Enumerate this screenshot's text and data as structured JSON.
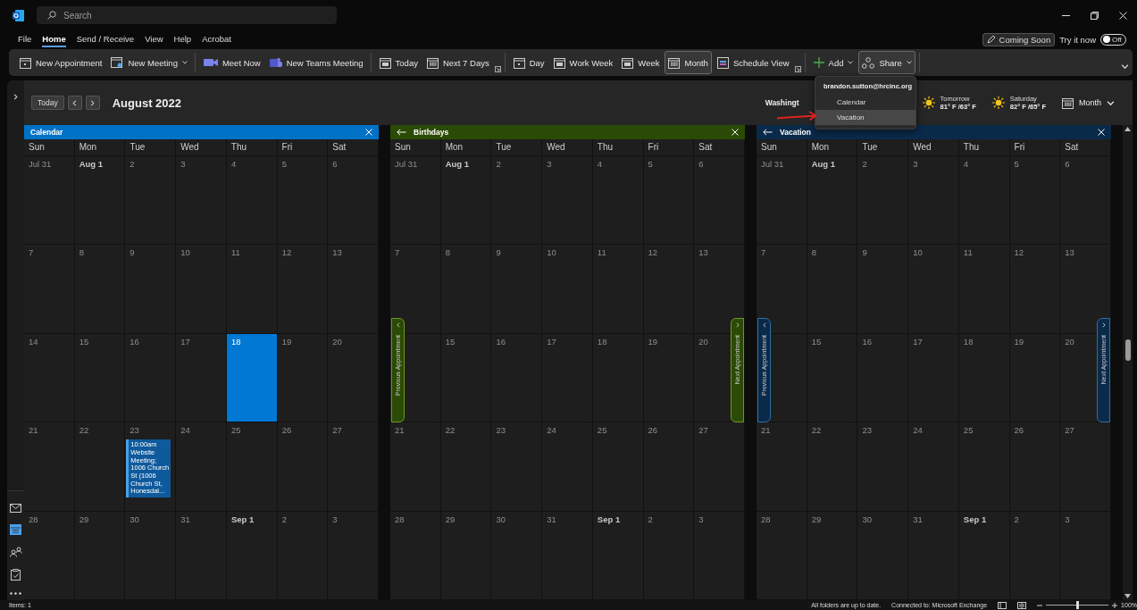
{
  "title_bar": {
    "search": {
      "placeholder": "Search"
    }
  },
  "menu": {
    "tabs": [
      {
        "label": "File",
        "selected": false
      },
      {
        "label": "Home",
        "selected": true
      },
      {
        "label": "Send / Receive",
        "selected": false
      },
      {
        "label": "View",
        "selected": false
      },
      {
        "label": "Help",
        "selected": false
      },
      {
        "label": "Acrobat",
        "selected": false
      }
    ],
    "coming_soon": "Coming Soon",
    "try_it_now": "Try it now",
    "toggle": {
      "label": "Off",
      "on": false
    }
  },
  "ribbon": {
    "groups": [
      {
        "launcher": false,
        "items": [
          {
            "label": "New Appointment",
            "caret": false,
            "active": false
          },
          {
            "label": "New Meeting",
            "caret": true,
            "active": false
          }
        ]
      },
      {
        "launcher": false,
        "items": [
          {
            "label": "Meet Now",
            "caret": false,
            "active": false
          },
          {
            "label": "New Teams Meeting",
            "caret": false,
            "active": false
          }
        ]
      },
      {
        "launcher": true,
        "items": [
          {
            "label": "Today",
            "caret": false,
            "active": false
          },
          {
            "label": "Next 7 Days",
            "caret": false,
            "active": false
          }
        ]
      },
      {
        "launcher": true,
        "items": [
          {
            "label": "Day",
            "caret": false,
            "active": false
          },
          {
            "label": "Work Week",
            "caret": false,
            "active": false
          },
          {
            "label": "Week",
            "caret": false,
            "active": false
          },
          {
            "label": "Month",
            "caret": false,
            "active": true
          },
          {
            "label": "Schedule View",
            "caret": false,
            "active": false
          }
        ]
      },
      {
        "launcher": false,
        "items": [
          {
            "label": "Add",
            "caret": true,
            "active": false
          },
          {
            "label": "Share",
            "caret": true,
            "active": true
          }
        ]
      }
    ]
  },
  "nav_rail": {
    "items": [
      {
        "selected": false
      },
      {
        "selected": true
      },
      {
        "selected": false
      },
      {
        "selected": false
      }
    ]
  },
  "header": {
    "today_button": "Today",
    "month_title": "August 2022",
    "location": "Washingt",
    "weather": [
      {
        "day": "Tomorrow",
        "temp": "81° F /63° F"
      },
      {
        "day": "Saturday",
        "temp": "82° F /65° F"
      }
    ],
    "view_picker": "Month"
  },
  "share_menu": {
    "account": "brandon.sutton@hrcinc.org",
    "items": [
      {
        "label": "Calendar",
        "highlighted": false
      },
      {
        "label": "Vacation",
        "highlighted": true
      }
    ]
  },
  "calendars": [
    {
      "title": "Calendar",
      "color": "#0072c6",
      "kind": "primary",
      "weekdays": [
        "Sun",
        "Mon",
        "Tue",
        "Wed",
        "Thu",
        "Fri",
        "Sat"
      ],
      "weeks": [
        [
          {
            "label": "Jul 31",
            "bold": false,
            "today": false
          },
          {
            "label": "Aug 1",
            "bold": true,
            "today": false
          },
          {
            "label": "2",
            "bold": false,
            "today": false
          },
          {
            "label": "3",
            "bold": false,
            "today": false
          },
          {
            "label": "4",
            "bold": false,
            "today": false
          },
          {
            "label": "5",
            "bold": false,
            "today": false
          },
          {
            "label": "6",
            "bold": false,
            "today": false
          }
        ],
        [
          {
            "label": "7",
            "bold": false,
            "today": false
          },
          {
            "label": "8",
            "bold": false,
            "today": false
          },
          {
            "label": "9",
            "bold": false,
            "today": false
          },
          {
            "label": "10",
            "bold": false,
            "today": false
          },
          {
            "label": "11",
            "bold": false,
            "today": false
          },
          {
            "label": "12",
            "bold": false,
            "today": false
          },
          {
            "label": "13",
            "bold": false,
            "today": false
          }
        ],
        [
          {
            "label": "14",
            "bold": false,
            "today": false
          },
          {
            "label": "15",
            "bold": false,
            "today": false
          },
          {
            "label": "16",
            "bold": false,
            "today": false
          },
          {
            "label": "17",
            "bold": false,
            "today": false
          },
          {
            "label": "18",
            "bold": false,
            "today": true
          },
          {
            "label": "19",
            "bold": false,
            "today": false
          },
          {
            "label": "20",
            "bold": false,
            "today": false
          }
        ],
        [
          {
            "label": "21",
            "bold": false,
            "today": false
          },
          {
            "label": "22",
            "bold": false,
            "today": false
          },
          {
            "label": "23",
            "bold": false,
            "today": false,
            "events": [
              "10:00am Website Meeting; 1006 Church St (1006 Church St, Honesdal..."
            ]
          },
          {
            "label": "24",
            "bold": false,
            "today": false
          },
          {
            "label": "25",
            "bold": false,
            "today": false
          },
          {
            "label": "26",
            "bold": false,
            "today": false
          },
          {
            "label": "27",
            "bold": false,
            "today": false
          }
        ],
        [
          {
            "label": "28",
            "bold": false,
            "today": false
          },
          {
            "label": "29",
            "bold": false,
            "today": false
          },
          {
            "label": "30",
            "bold": false,
            "today": false
          },
          {
            "label": "31",
            "bold": false,
            "today": false
          },
          {
            "label": "Sep 1",
            "bold": true,
            "today": false
          },
          {
            "label": "2",
            "bold": false,
            "today": false
          },
          {
            "label": "3",
            "bold": false,
            "today": false
          }
        ]
      ]
    },
    {
      "title": "Birthdays",
      "color": "#2b4a05",
      "kind": "overlay",
      "previous_tab": "Previous Appointment",
      "next_tab": "Next Appointment",
      "weekdays": [
        "Sun",
        "Mon",
        "Tue",
        "Wed",
        "Thu",
        "Fri",
        "Sat"
      ],
      "weeks": [
        [
          {
            "label": "Jul 31",
            "bold": false,
            "today": false
          },
          {
            "label": "Aug 1",
            "bold": true,
            "today": false
          },
          {
            "label": "2",
            "bold": false,
            "today": false
          },
          {
            "label": "3",
            "bold": false,
            "today": false
          },
          {
            "label": "4",
            "bold": false,
            "today": false
          },
          {
            "label": "5",
            "bold": false,
            "today": false
          },
          {
            "label": "6",
            "bold": false,
            "today": false
          }
        ],
        [
          {
            "label": "7",
            "bold": false,
            "today": false
          },
          {
            "label": "8",
            "bold": false,
            "today": false
          },
          {
            "label": "9",
            "bold": false,
            "today": false
          },
          {
            "label": "10",
            "bold": false,
            "today": false
          },
          {
            "label": "11",
            "bold": false,
            "today": false
          },
          {
            "label": "12",
            "bold": false,
            "today": false
          },
          {
            "label": "13",
            "bold": false,
            "today": false
          }
        ],
        [
          {
            "today": false
          },
          {
            "label": "15",
            "bold": false,
            "today": false
          },
          {
            "label": "16",
            "bold": false,
            "today": false
          },
          {
            "label": "17",
            "bold": false,
            "today": false
          },
          {
            "label": "18",
            "bold": false,
            "today": false
          },
          {
            "label": "19",
            "bold": false,
            "today": false
          },
          {
            "label": "20",
            "bold": false,
            "today": false
          }
        ],
        [
          {
            "label": "21",
            "bold": false,
            "today": false
          },
          {
            "label": "22",
            "bold": false,
            "today": false
          },
          {
            "label": "23",
            "bold": false,
            "today": false
          },
          {
            "label": "24",
            "bold": false,
            "today": false
          },
          {
            "label": "25",
            "bold": false,
            "today": false
          },
          {
            "label": "26",
            "bold": false,
            "today": false
          },
          {
            "label": "27",
            "bold": false,
            "today": false
          }
        ],
        [
          {
            "label": "28",
            "bold": false,
            "today": false
          },
          {
            "label": "29",
            "bold": false,
            "today": false
          },
          {
            "label": "30",
            "bold": false,
            "today": false
          },
          {
            "label": "31",
            "bold": false,
            "today": false
          },
          {
            "label": "Sep 1",
            "bold": true,
            "today": false
          },
          {
            "label": "2",
            "bold": false,
            "today": false
          },
          {
            "label": "3",
            "bold": false,
            "today": false
          }
        ]
      ]
    },
    {
      "title": "Vacation",
      "color": "#0a2a4a",
      "kind": "overlay",
      "previous_tab": "Previous Appointment",
      "next_tab": "Next Appointment",
      "weekdays": [
        "Sun",
        "Mon",
        "Tue",
        "Wed",
        "Thu",
        "Fri",
        "Sat"
      ],
      "weeks": [
        [
          {
            "label": "Jul 31",
            "bold": false,
            "today": false
          },
          {
            "label": "Aug 1",
            "bold": true,
            "today": false
          },
          {
            "label": "2",
            "bold": false,
            "today": false
          },
          {
            "label": "3",
            "bold": false,
            "today": false
          },
          {
            "label": "4",
            "bold": false,
            "today": false
          },
          {
            "label": "5",
            "bold": false,
            "today": false
          },
          {
            "label": "6",
            "bold": false,
            "today": false
          }
        ],
        [
          {
            "label": "7",
            "bold": false,
            "today": false
          },
          {
            "label": "8",
            "bold": false,
            "today": false
          },
          {
            "label": "9",
            "bold": false,
            "today": false
          },
          {
            "label": "10",
            "bold": false,
            "today": false
          },
          {
            "label": "11",
            "bold": false,
            "today": false
          },
          {
            "label": "12",
            "bold": false,
            "today": false
          },
          {
            "label": "13",
            "bold": false,
            "today": false
          }
        ],
        [
          {
            "today": false
          },
          {
            "label": "15",
            "bold": false,
            "today": false
          },
          {
            "label": "16",
            "bold": false,
            "today": false
          },
          {
            "label": "17",
            "bold": false,
            "today": false
          },
          {
            "label": "18",
            "bold": false,
            "today": false
          },
          {
            "label": "19",
            "bold": false,
            "today": false
          },
          {
            "label": "20",
            "bold": false,
            "today": false
          }
        ],
        [
          {
            "label": "21",
            "bold": false,
            "today": false
          },
          {
            "label": "22",
            "bold": false,
            "today": false
          },
          {
            "label": "23",
            "bold": false,
            "today": false
          },
          {
            "label": "24",
            "bold": false,
            "today": false
          },
          {
            "label": "25",
            "bold": false,
            "today": false
          },
          {
            "label": "26",
            "bold": false,
            "today": false
          },
          {
            "label": "27",
            "bold": false,
            "today": false
          }
        ],
        [
          {
            "label": "28",
            "bold": false,
            "today": false
          },
          {
            "label": "29",
            "bold": false,
            "today": false
          },
          {
            "label": "30",
            "bold": false,
            "today": false
          },
          {
            "label": "31",
            "bold": false,
            "today": false
          },
          {
            "label": "Sep 1",
            "bold": true,
            "today": false
          },
          {
            "label": "2",
            "bold": false,
            "today": false
          },
          {
            "label": "3",
            "bold": false,
            "today": false
          }
        ]
      ]
    }
  ],
  "status_bar": {
    "items": "Items: 1",
    "sync": "All folders are up to date.",
    "connection": "Connected to: Microsoft Exchange",
    "zoom": {
      "level": 0.5,
      "reading": "100%"
    }
  }
}
